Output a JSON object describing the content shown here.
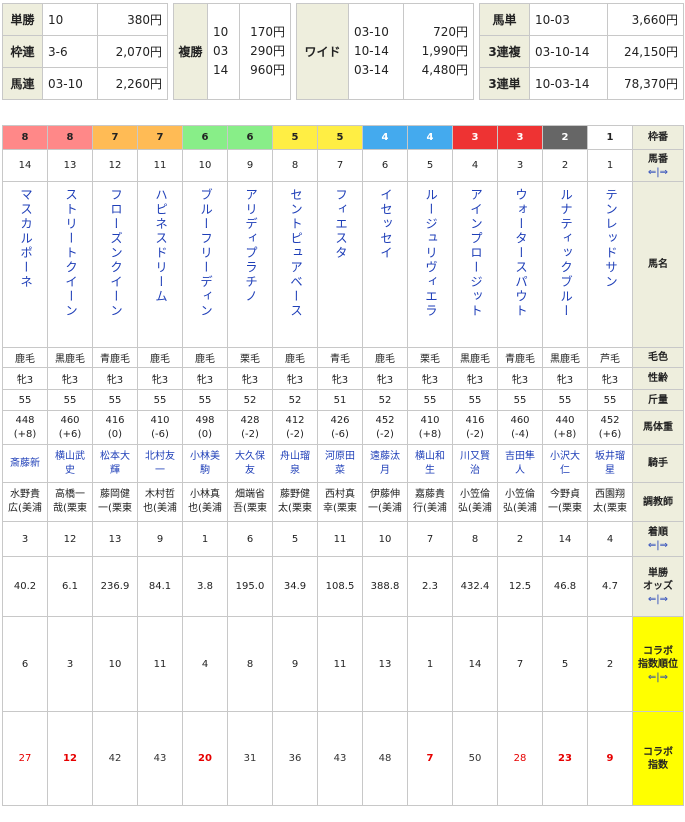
{
  "payouts": {
    "tansho": {
      "label": "単勝",
      "combo": "10",
      "yen": "380円"
    },
    "wakuren": {
      "label": "枠連",
      "combo": "3-6",
      "yen": "2,070円"
    },
    "umaren": {
      "label": "馬連",
      "combo": "03-10",
      "yen": "2,260円"
    },
    "fukusho": {
      "label": "複勝",
      "combos": [
        "10",
        "03",
        "14"
      ],
      "yens": [
        "170円",
        "290円",
        "960円"
      ]
    },
    "wide": {
      "label": "ワイド",
      "combos": [
        "03-10",
        "10-14",
        "03-14"
      ],
      "yens": [
        "720円",
        "1,990円",
        "4,480円"
      ]
    },
    "umatan": {
      "label": "馬単",
      "combo": "10-03",
      "yen": "3,660円"
    },
    "sanrenpuku": {
      "label": "3連複",
      "combo": "03-10-14",
      "yen": "24,150円"
    },
    "sanrentan": {
      "label": "3連単",
      "combo": "10-03-14",
      "yen": "78,370円"
    }
  },
  "row_labels": {
    "waku": "枠番",
    "umaban": "馬番",
    "umaban_sort": "⇐|⇒",
    "name": "馬名",
    "color": "毛色",
    "sexage": "性齢",
    "weight": "斤量",
    "body": "馬体重",
    "jockey": "騎手",
    "trainer": "調教師",
    "finish": "着順",
    "finish_sort": "⇐|⇒",
    "odds1": "単勝",
    "odds2": "オッズ",
    "odds_sort": "⇐|⇒",
    "collab_rank1": "コラボ",
    "collab_rank2": "指数順位",
    "collab_rank_sort": "⇐|⇒",
    "collab_index1": "コラボ",
    "collab_index2": "指数"
  },
  "colors": {
    "waku1": "#ffffff",
    "waku2": "#666666",
    "waku3": "#ee3333",
    "waku4": "#44aaee",
    "waku5": "#ffee44",
    "waku6": "#88ee88",
    "waku7": "#ffbb55",
    "waku8": "#ff8888",
    "header_bg": "#eeeedd",
    "collab_bg": "#ffff00",
    "link": "#1f3fb8",
    "highlight_red": "#e60000"
  },
  "horses": [
    {
      "waku": "8",
      "num": "14",
      "name": "マスカルポーネ",
      "color": "鹿毛",
      "sexage": "牝3",
      "weight": "55",
      "body": "448",
      "diff": "(+8)",
      "jockey1": "斎藤新",
      "jockey2": "",
      "trainer1": "水野貴",
      "trainer2": "広(美浦",
      "finish": "3",
      "odds": "40.2",
      "rank": "6",
      "index": "27",
      "index_style": "red"
    },
    {
      "waku": "8",
      "num": "13",
      "name": "ストリートクイーン",
      "color": "黒鹿毛",
      "sexage": "牝3",
      "weight": "55",
      "body": "460",
      "diff": "(+6)",
      "jockey1": "横山武",
      "jockey2": "史",
      "trainer1": "高橋一",
      "trainer2": "哉(栗東",
      "finish": "12",
      "odds": "6.1",
      "rank": "3",
      "index": "12",
      "index_style": "redbold"
    },
    {
      "waku": "7",
      "num": "12",
      "name": "フローズンクイーン",
      "color": "青鹿毛",
      "sexage": "牝3",
      "weight": "55",
      "body": "416",
      "diff": "(0)",
      "jockey1": "松本大",
      "jockey2": "輝",
      "trainer1": "藤岡健",
      "trainer2": "一(栗東",
      "finish": "13",
      "odds": "236.9",
      "rank": "10",
      "index": "42",
      "index_style": "black"
    },
    {
      "waku": "7",
      "num": "11",
      "name": "ハピネスドリーム",
      "color": "鹿毛",
      "sexage": "牝3",
      "weight": "55",
      "body": "410",
      "diff": "(-6)",
      "jockey1": "北村友",
      "jockey2": "一",
      "trainer1": "木村哲",
      "trainer2": "也(美浦",
      "finish": "9",
      "odds": "84.1",
      "rank": "11",
      "index": "43",
      "index_style": "black"
    },
    {
      "waku": "6",
      "num": "10",
      "name": "ブルーフリーディン",
      "color": "鹿毛",
      "sexage": "牝3",
      "weight": "55",
      "body": "498",
      "diff": "(0)",
      "jockey1": "小林美",
      "jockey2": "駒",
      "trainer1": "小林真",
      "trainer2": "也(美浦",
      "finish": "1",
      "odds": "3.8",
      "rank": "4",
      "index": "20",
      "index_style": "redbold"
    },
    {
      "waku": "6",
      "num": "9",
      "name": "アリディプラチノ",
      "color": "栗毛",
      "sexage": "牝3",
      "weight": "52",
      "body": "428",
      "diff": "(-2)",
      "jockey1": "大久保",
      "jockey2": "友",
      "trainer1": "畑端省",
      "trainer2": "吾(栗東",
      "finish": "6",
      "odds": "195.0",
      "rank": "8",
      "index": "31",
      "index_style": "black"
    },
    {
      "waku": "5",
      "num": "8",
      "name": "セントピュアベース",
      "color": "鹿毛",
      "sexage": "牝3",
      "weight": "52",
      "body": "412",
      "diff": "(-2)",
      "jockey1": "舟山瑠",
      "jockey2": "泉",
      "trainer1": "藤野健",
      "trainer2": "太(栗東",
      "finish": "5",
      "odds": "34.9",
      "rank": "9",
      "index": "36",
      "index_style": "black"
    },
    {
      "waku": "5",
      "num": "7",
      "name": "フィエスタ",
      "color": "青毛",
      "sexage": "牝3",
      "weight": "51",
      "body": "426",
      "diff": "(-6)",
      "jockey1": "河原田",
      "jockey2": "菜",
      "trainer1": "西村真",
      "trainer2": "幸(栗東",
      "finish": "11",
      "odds": "108.5",
      "rank": "11",
      "index": "43",
      "index_style": "black"
    },
    {
      "waku": "4",
      "num": "6",
      "name": "イセッセイ",
      "color": "鹿毛",
      "sexage": "牝3",
      "weight": "52",
      "body": "452",
      "diff": "(-2)",
      "jockey1": "遠藤汰",
      "jockey2": "月",
      "trainer1": "伊藤伸",
      "trainer2": "一(美浦",
      "finish": "10",
      "odds": "388.8",
      "rank": "13",
      "index": "48",
      "index_style": "black"
    },
    {
      "waku": "4",
      "num": "5",
      "name": "ルージュリヴィエラ",
      "color": "栗毛",
      "sexage": "牝3",
      "weight": "55",
      "body": "410",
      "diff": "(+8)",
      "jockey1": "横山和",
      "jockey2": "生",
      "trainer1": "嘉藤貴",
      "trainer2": "行(美浦",
      "finish": "7",
      "odds": "2.3",
      "rank": "1",
      "index": "7",
      "index_style": "redbold"
    },
    {
      "waku": "3",
      "num": "4",
      "name": "アインプロージット",
      "color": "黒鹿毛",
      "sexage": "牝3",
      "weight": "55",
      "body": "416",
      "diff": "(-2)",
      "jockey1": "川又賢",
      "jockey2": "治",
      "trainer1": "小笠倫",
      "trainer2": "弘(美浦",
      "finish": "8",
      "odds": "432.4",
      "rank": "14",
      "index": "50",
      "index_style": "black"
    },
    {
      "waku": "3",
      "num": "3",
      "name": "ウォータースパウト",
      "color": "青鹿毛",
      "sexage": "牝3",
      "weight": "55",
      "body": "460",
      "diff": "(-4)",
      "jockey1": "吉田隼",
      "jockey2": "人",
      "trainer1": "小笠倫",
      "trainer2": "弘(美浦",
      "finish": "2",
      "odds": "12.5",
      "rank": "7",
      "index": "28",
      "index_style": "red"
    },
    {
      "waku": "2",
      "num": "2",
      "name": "ルナティックブルー",
      "color": "黒鹿毛",
      "sexage": "牝3",
      "weight": "55",
      "body": "440",
      "diff": "(+8)",
      "jockey1": "小沢大",
      "jockey2": "仁",
      "trainer1": "今野貞",
      "trainer2": "一(栗東",
      "finish": "14",
      "odds": "46.8",
      "rank": "5",
      "index": "23",
      "index_style": "redbold"
    },
    {
      "waku": "1",
      "num": "1",
      "name": "テンレッドサン",
      "color": "芦毛",
      "sexage": "牝3",
      "weight": "55",
      "body": "452",
      "diff": "(+6)",
      "jockey1": "坂井瑠",
      "jockey2": "星",
      "trainer1": "西園翔",
      "trainer2": "太(栗東",
      "finish": "4",
      "odds": "4.7",
      "rank": "2",
      "index": "9",
      "index_style": "redbold"
    }
  ]
}
